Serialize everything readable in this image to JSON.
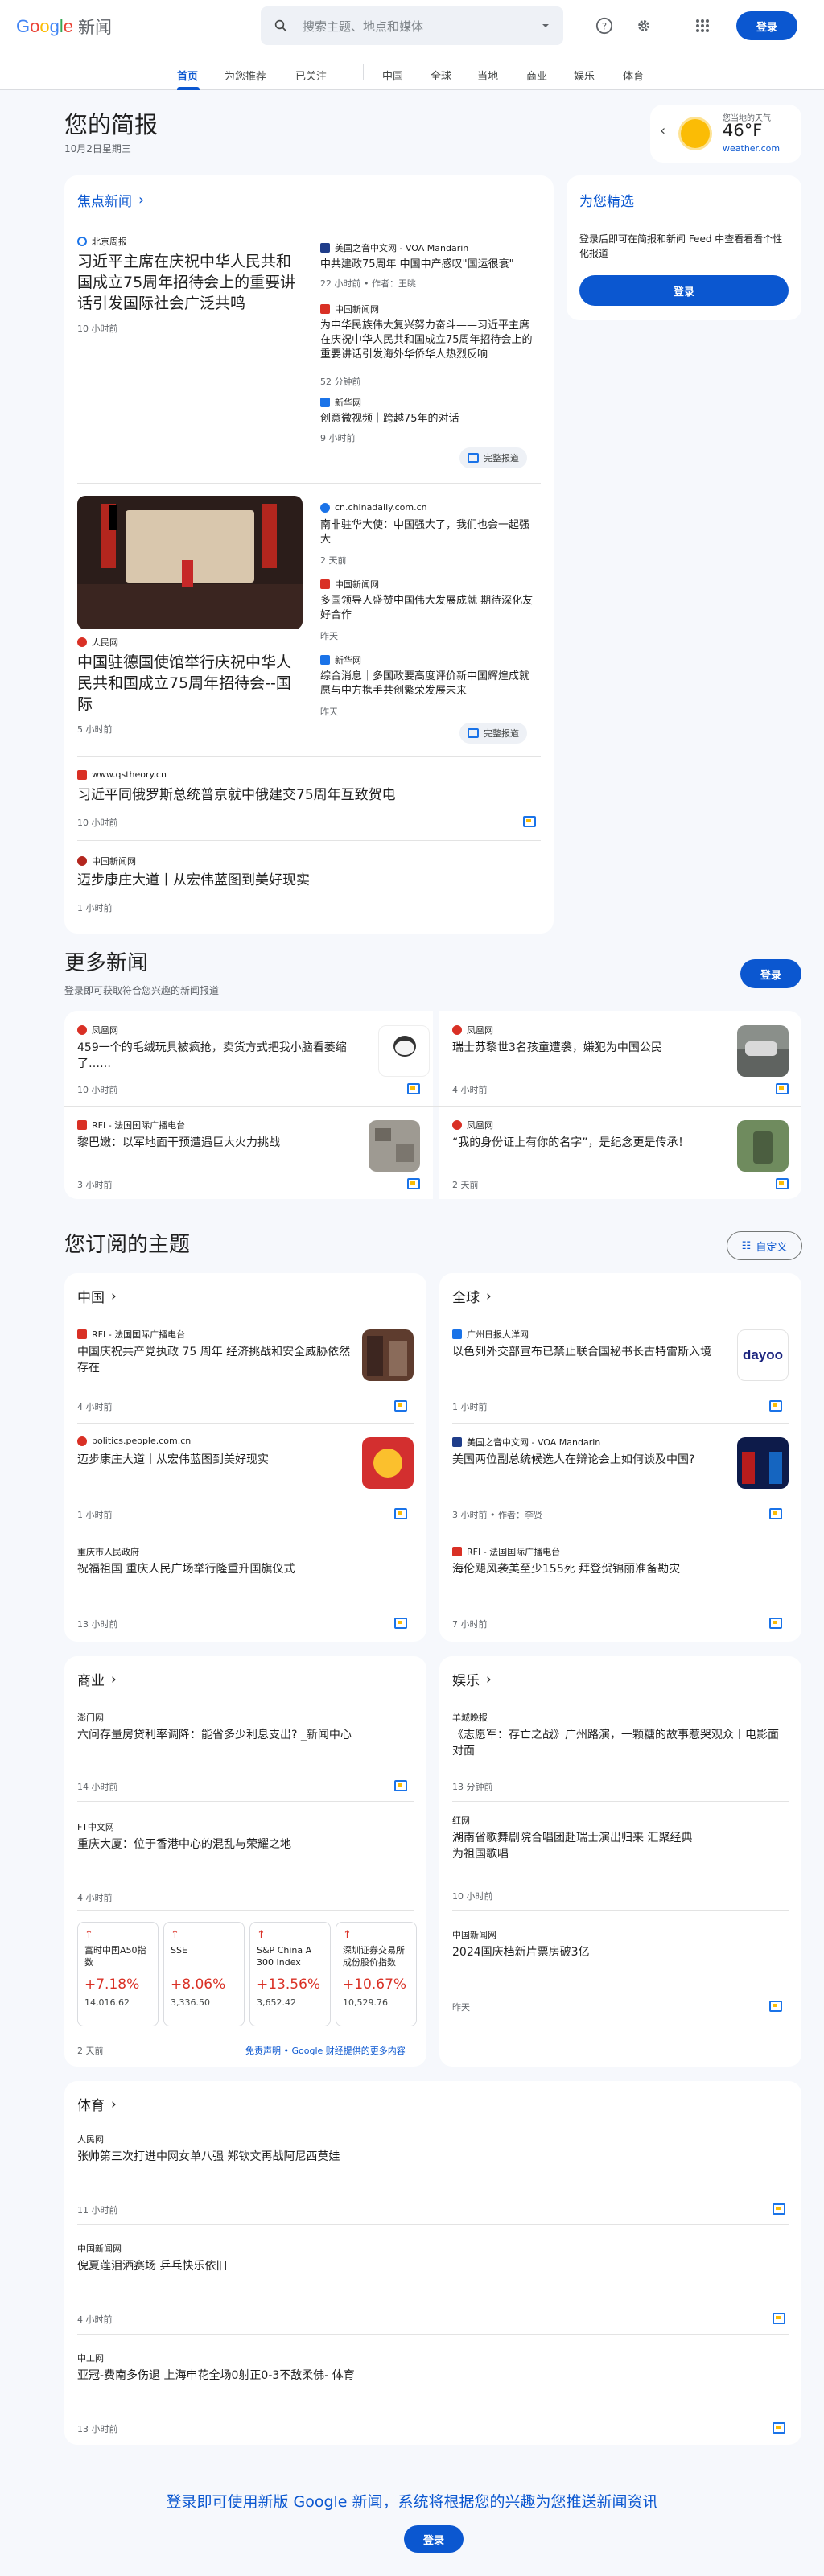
{
  "header": {
    "logo_google": "Google",
    "logo_news": "新闻",
    "search_placeholder": "搜索主题、地点和媒体",
    "signin": "登录"
  },
  "nav": [
    "首页",
    "为您推荐",
    "已关注",
    "中国",
    "全球",
    "当地",
    "商业",
    "娱乐",
    "体育"
  ],
  "briefing": {
    "title": "您的简报",
    "date": "10月2日星期三"
  },
  "weather": {
    "label": "您当地的天气",
    "temp": "46°F",
    "source": "weather.com"
  },
  "top_stories": {
    "heading": "焦点新闻",
    "full_coverage": "完整报道",
    "group1": {
      "main": {
        "source": "北京周报",
        "title": "习近平主席在庆祝中华人民共和国成立75周年招待会上的重要讲话引发国际社会广泛共鸣",
        "time": "10 小时前"
      },
      "side": [
        {
          "source": "美国之音中文网 - VOA Mandarin",
          "title": "中共建政75周年 中国中产感叹\"国运很衰\"",
          "time": "22 小时前 • 作者：王眺"
        },
        {
          "source": "中国新闻网",
          "title": "为中华民族伟大复兴努力奋斗——习近平主席在庆祝中华人民共和国成立75周年招待会上的重要讲话引发海外华侨华人热烈反响",
          "time": "52 分钟前"
        },
        {
          "source": "新华网",
          "title": "创意微视频｜跨越75年的对话",
          "time": "9 小时前"
        }
      ]
    },
    "group2": {
      "main": {
        "source": "人民网",
        "title": "中国驻德国使馆举行庆祝中华人民共和国成立75周年招待会--国际",
        "time": "5 小时前"
      },
      "side": [
        {
          "source": "cn.chinadaily.com.cn",
          "title": "南非驻华大使：中国强大了，我们也会一起强大",
          "time": "2 天前"
        },
        {
          "source": "中国新闻网",
          "title": "多国领导人盛赞中国伟大发展成就 期待深化友好合作",
          "time": "昨天"
        },
        {
          "source": "新华网",
          "title": "综合消息｜多国政要高度评价新中国辉煌成就 愿与中方携手共创繁荣发展未来",
          "time": "昨天"
        }
      ]
    },
    "single1": {
      "source": "www.qstheory.cn",
      "title": "习近平同俄罗斯总统普京就中俄建交75周年互致贺电",
      "time": "10 小时前"
    },
    "single2": {
      "source": "中国新闻网",
      "title": "迈步康庄大道丨从宏伟蓝图到美好现实",
      "time": "1 小时前"
    }
  },
  "picks": {
    "title": "为您精选",
    "desc": "登录后即可在简报和新闻 Feed 中查看看看个性化报道",
    "signin": "登录"
  },
  "more_news": {
    "title": "更多新闻",
    "subtitle": "登录即可获取符合您兴趣的新闻报道",
    "signin": "登录",
    "items": [
      {
        "source": "凤凰网",
        "title": "459一个的毛绒玩具被疯抢，卖货方式把我小脑看萎缩了……",
        "time": "10 小时前"
      },
      {
        "source": "凤凰网",
        "title": "瑞士苏黎世3名孩童遭袭，嫌犯为中国公民",
        "time": "4 小时前"
      },
      {
        "source": "RFI - 法国国际广播电台",
        "title": "黎巴嫩：以军地面干预遭遇巨大火力挑战",
        "time": "3 小时前"
      },
      {
        "source": "凤凰网",
        "title": "“我的身份证上有你的名字”，是纪念更是传承！",
        "time": "2 天前"
      }
    ]
  },
  "topics": {
    "title": "您订阅的主题",
    "customize": "自定义",
    "china": {
      "title": "中国",
      "items": [
        {
          "source": "RFI - 法国国际广播电台",
          "title": "中国庆祝共产党执政 75 周年 经济挑战和安全威胁依然存在",
          "time": "4 小时前"
        },
        {
          "source": "politics.people.com.cn",
          "title": "迈步康庄大道丨从宏伟蓝图到美好现实",
          "time": "1 小时前"
        },
        {
          "source": "重庆市人民政府",
          "title": "祝福祖国 重庆人民广场举行隆重升国旗仪式",
          "time": "13 小时前"
        }
      ]
    },
    "world": {
      "title": "全球",
      "items": [
        {
          "source": "广州日报大洋网",
          "title": "以色列外交部宣布已禁止联合国秘书长古特雷斯入境",
          "time": "1 小时前",
          "thumb": "dayoo"
        },
        {
          "source": "美国之音中文网 - VOA Mandarin",
          "title": "美国两位副总统候选人在辩论会上如何谈及中国?",
          "time": "3 小时前 • 作者：李贤"
        },
        {
          "source": "RFI - 法国国际广播电台",
          "title": "海伦飓风袭美至少155死 拜登贺锦丽准备勘灾",
          "time": "7 小时前"
        }
      ]
    },
    "business": {
      "title": "商业",
      "items": [
        {
          "source": "澎门网",
          "title": "六问存量房贷利率调降：能省多少利息支出? _新闻中心",
          "time": "14 小时前"
        },
        {
          "source": "FT中文网",
          "title": "重庆大厦：位于香港中心的混乱与荣耀之地",
          "time": "4 小时前"
        }
      ],
      "stocks": [
        {
          "name": "富时中国A50指数",
          "change": "+7.18%",
          "value": "14,016.62"
        },
        {
          "name": "SSE",
          "change": "+8.06%",
          "value": "3,336.50"
        },
        {
          "name": "S&P China A 300 Index (CNY)",
          "change": "+13.56%",
          "value": "3,652.42"
        },
        {
          "name": "深圳证券交易所成份股价指数",
          "change": "+10.67%",
          "value": "10,529.76"
        }
      ],
      "stocks_time": "2 天前",
      "disclaimer": "免责声明 • Google 财经提供的更多内容"
    },
    "entertainment": {
      "title": "娱乐",
      "items": [
        {
          "source": "羊城晚报",
          "title": "《志愿军：存亡之战》广州路演，一颗糖的故事惹哭观众丨电影面对面",
          "time": "13 分钟前"
        },
        {
          "source": "红网",
          "title": "湖南省歌舞剧院合唱团赴瑞士演出归来 汇聚经典为祖国歌唱",
          "time": "10 小时前"
        },
        {
          "source": "中国新闻网",
          "title": "2024国庆档新片票房破3亿",
          "time": "昨天"
        }
      ]
    },
    "sports": {
      "title": "体育",
      "items": [
        {
          "source": "人民网",
          "title": "张帅第三次打进中网女单八强 郑钦文再战阿尼西莫娃",
          "time": "11 小时前"
        },
        {
          "source": "中国新闻网",
          "title": "倪夏莲泪洒赛场 乒乓快乐依旧",
          "time": "4 小时前"
        },
        {
          "source": "中工网",
          "title": "亚冠-费南多伤退 上海申花全场0射正0-3不敌柔佛- 体育",
          "time": "13 小时前"
        }
      ]
    }
  },
  "footer": {
    "cta": "登录即可使用新版 Google 新闻，系统将根据您的兴趣为您推送新闻资讯",
    "signin": "登录"
  },
  "colors": {
    "accent": "#0b57d0",
    "positive": "#d93025",
    "background": "#f6f8fc"
  }
}
